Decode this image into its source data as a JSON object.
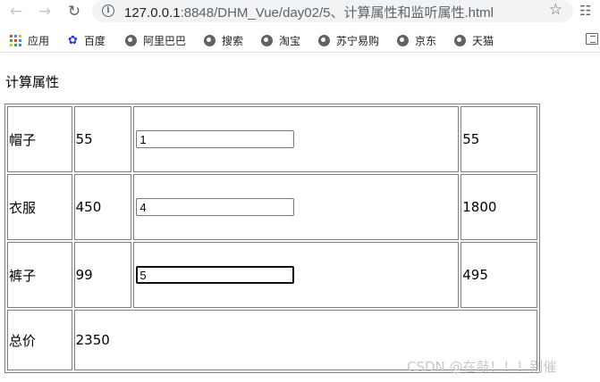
{
  "browser": {
    "url_host": "127.0.0.1",
    "url_rest": ":8848/DHM_Vue/day02/5、计算属性和监听属性.html",
    "bookmarks": [
      "应用",
      "百度",
      "阿里巴巴",
      "搜索",
      "淘宝",
      "苏宁易购",
      "京东",
      "天猫"
    ]
  },
  "page": {
    "title": "计算属性",
    "items": [
      {
        "name": "帽子",
        "price": "55",
        "quantity": "1",
        "subtotal": "55"
      },
      {
        "name": "衣服",
        "price": "450",
        "quantity": "4",
        "subtotal": "1800"
      },
      {
        "name": "裤子",
        "price": "99",
        "quantity": "5",
        "subtotal": "495"
      }
    ],
    "total_label": "总价",
    "total_value": "2350"
  },
  "watermark": "CSDN @在敲！！！别催",
  "colors": {
    "accent_baidu": "#2932e1",
    "border": "#808080"
  }
}
